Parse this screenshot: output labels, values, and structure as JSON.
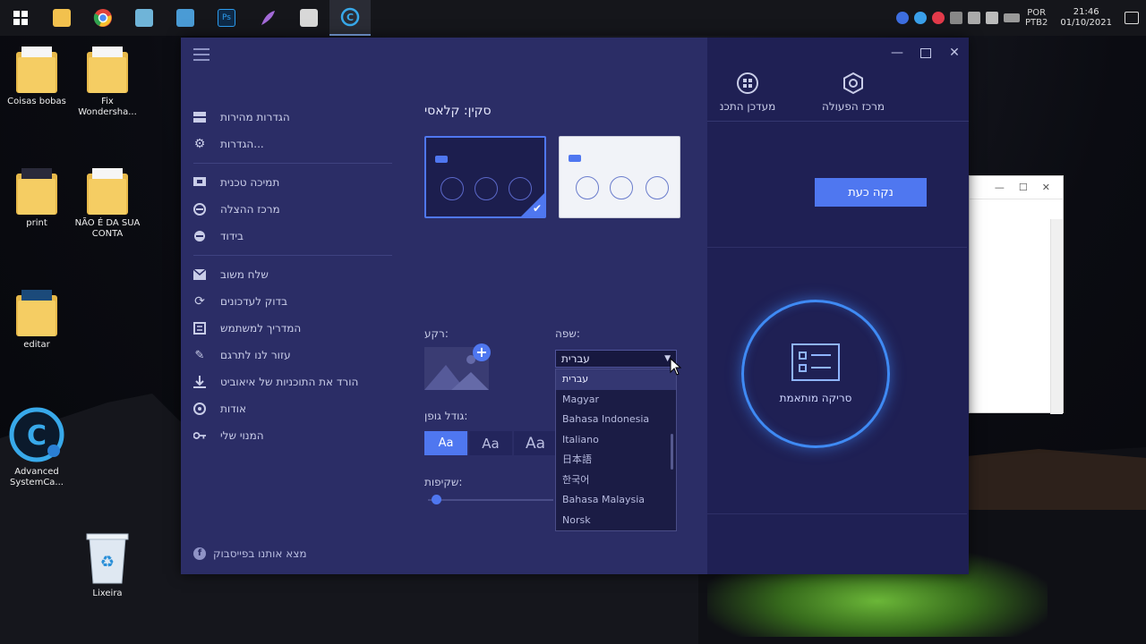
{
  "taskbar": {
    "apps": [
      {
        "name": "start-icon",
        "color": "#ffffff"
      },
      {
        "name": "file-explorer-icon",
        "color": "#f2c14e"
      },
      {
        "name": "chrome-icon",
        "color": "#e0433a"
      },
      {
        "name": "app-icon",
        "color": "#6fb4d8"
      },
      {
        "name": "app-icon-2",
        "color": "#4a9bd5"
      },
      {
        "name": "photoshop-icon",
        "color": "#2d9df0"
      },
      {
        "name": "feather-icon",
        "color": "#a36ad8"
      },
      {
        "name": "app-icon-3",
        "color": "#d8d8d8"
      },
      {
        "name": "advanced-systemcare-icon",
        "color": "#38a9ea"
      }
    ],
    "lang_top": "POR",
    "lang_bottom": "PTB2",
    "time": "21:46",
    "date": "01/10/2021"
  },
  "desktop": {
    "icons": [
      {
        "label": "Coisas bobas"
      },
      {
        "label": "Fix Wondersha..."
      },
      {
        "label": "print"
      },
      {
        "label": "NÃO É DA SUA CONTA"
      },
      {
        "label": "editar"
      },
      {
        "label": "Advanced SystemCa..."
      },
      {
        "label": "Lixeira"
      }
    ]
  },
  "menu": {
    "items": [
      {
        "label": "הגדרות מהירות",
        "icon": "quick-settings-icon"
      },
      {
        "label": "הגדרות...",
        "icon": "gear-icon"
      },
      {
        "label": "תמיכה טכנית",
        "icon": "support-icon"
      },
      {
        "label": "מרכז ההצלה",
        "icon": "rescue-icon"
      },
      {
        "label": "בידוד",
        "icon": "quarantine-icon"
      },
      {
        "label": "שלח משוב",
        "icon": "feedback-icon"
      },
      {
        "label": "בדוק לעדכונים",
        "icon": "refresh-icon"
      },
      {
        "label": "המדריך למשתמש",
        "icon": "guide-icon"
      },
      {
        "label": "עזור לנו לתרגם",
        "icon": "pencil-icon"
      },
      {
        "label": "הורד את התוכניות של איאוביט",
        "icon": "download-icon"
      },
      {
        "label": "אודות",
        "icon": "info-icon"
      },
      {
        "label": "המנוי שלי",
        "icon": "key-icon"
      }
    ],
    "facebook": "מצא אותנו בפייסבוק"
  },
  "settings": {
    "skin_title": "סקין: קלאסי",
    "background_label": "רקע:",
    "language_label": "שפה:",
    "font_size_label": "גודל גופן:",
    "transparency_label": "שקיפות:",
    "font_sizes": [
      "Aa",
      "Aa",
      "Aa"
    ],
    "transparency_value": 0.05,
    "language_selected": "עברית",
    "language_options": [
      "עברית",
      "Magyar",
      "Bahasa Indonesia",
      "Italiano",
      "日本語",
      "한국어",
      "Bahasa Malaysia",
      "Norsk"
    ]
  },
  "main": {
    "tabs": [
      "מרכז הפעולה",
      "מעדכן התכנ"
    ],
    "clean_button": "נקה כעת",
    "scan_label": "סריקה מותאמת"
  },
  "colors": {
    "accent": "#4f77f0",
    "panel": "#2b2d66",
    "window": "#1f2054"
  }
}
